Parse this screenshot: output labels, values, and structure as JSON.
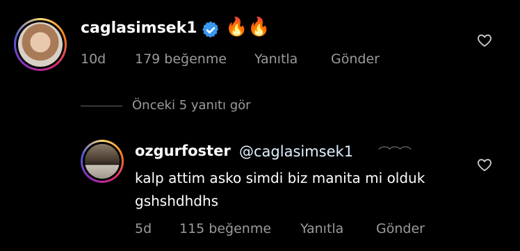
{
  "comment1": {
    "username": "caglasimsek1",
    "emojis": [
      "🔥",
      "🔥"
    ],
    "time": "10d",
    "likes": "179 beğenme",
    "reply_label": "Yanıtla",
    "send_label": "Gönder"
  },
  "view_previous": "Önceki 5 yanıtı gör",
  "comment2": {
    "username": "ozgurfoster",
    "mention": "@caglasimsek1",
    "text": "kalp attim asko simdi biz manita mi olduk gshshdhdhs",
    "time": "5d",
    "likes": "115 beğenme",
    "reply_label": "Yanıtla",
    "send_label": "Gönder"
  },
  "colors": {
    "background": "#000000",
    "verified": "#3897f0",
    "muted": "#9b9b9b"
  }
}
